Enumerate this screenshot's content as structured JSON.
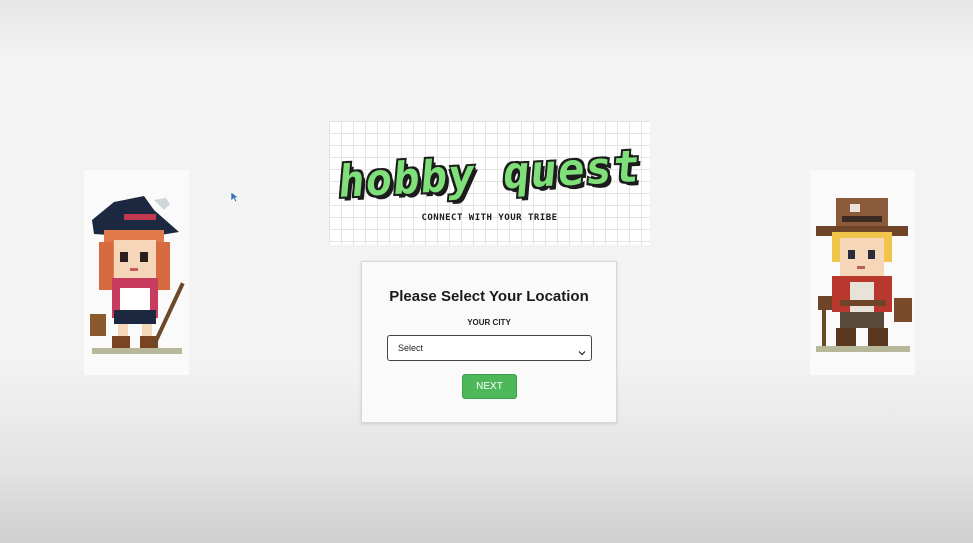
{
  "banner": {
    "title": "hobby quest",
    "tagline": "CONNECT WITH YOUR TRIBE"
  },
  "form": {
    "heading": "Please Select Your Location",
    "city_label": "YOUR CITY",
    "city_select_value": "Select",
    "next_label": "NEXT"
  },
  "icons": {
    "left_character": "witch-adventurer-pixel-art",
    "right_character": "explorer-adventurer-pixel-art",
    "cursor": "mouse-pointer-icon",
    "dropdown": "chevron-down-icon"
  },
  "colors": {
    "logo_green": "#7fe07a",
    "button_green": "#4cb85a"
  }
}
